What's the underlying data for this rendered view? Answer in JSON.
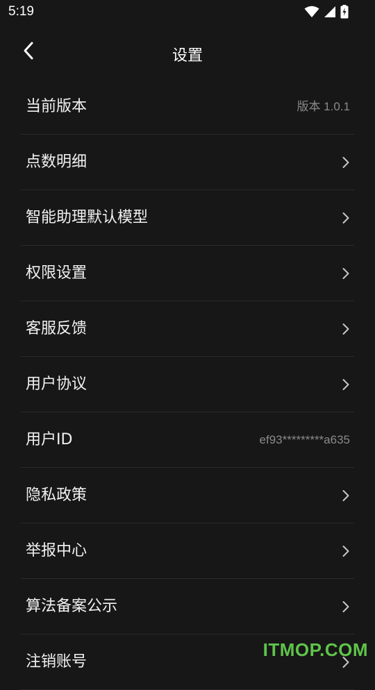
{
  "status_bar": {
    "time": "5:19",
    "icons": [
      "wifi-icon",
      "signal-icon",
      "battery-charging-icon"
    ]
  },
  "header": {
    "title": "设置",
    "back_icon": "chevron-left-icon"
  },
  "settings": [
    {
      "key": "version",
      "label": "当前版本",
      "value": "版本 1.0.1",
      "chevron": false
    },
    {
      "key": "points",
      "label": "点数明细",
      "value": "",
      "chevron": true
    },
    {
      "key": "default-model",
      "label": "智能助理默认模型",
      "value": "",
      "chevron": true
    },
    {
      "key": "permissions",
      "label": "权限设置",
      "value": "",
      "chevron": true
    },
    {
      "key": "feedback",
      "label": "客服反馈",
      "value": "",
      "chevron": true
    },
    {
      "key": "user-agreement",
      "label": "用户协议",
      "value": "",
      "chevron": true
    },
    {
      "key": "user-id",
      "label": "用户ID",
      "value": "ef93*********a635",
      "chevron": false
    },
    {
      "key": "privacy",
      "label": "隐私政策",
      "value": "",
      "chevron": true
    },
    {
      "key": "report-center",
      "label": "举报中心",
      "value": "",
      "chevron": true
    },
    {
      "key": "algorithm",
      "label": "算法备案公示",
      "value": "",
      "chevron": true
    },
    {
      "key": "delete-account",
      "label": "注销账号",
      "value": "",
      "chevron": true
    }
  ],
  "watermark": "ITMOP.COM",
  "colors": {
    "background": "#171717",
    "divider": "#2a2a2a",
    "secondary_text": "#8a8a8a",
    "watermark": "#5fc44a"
  }
}
